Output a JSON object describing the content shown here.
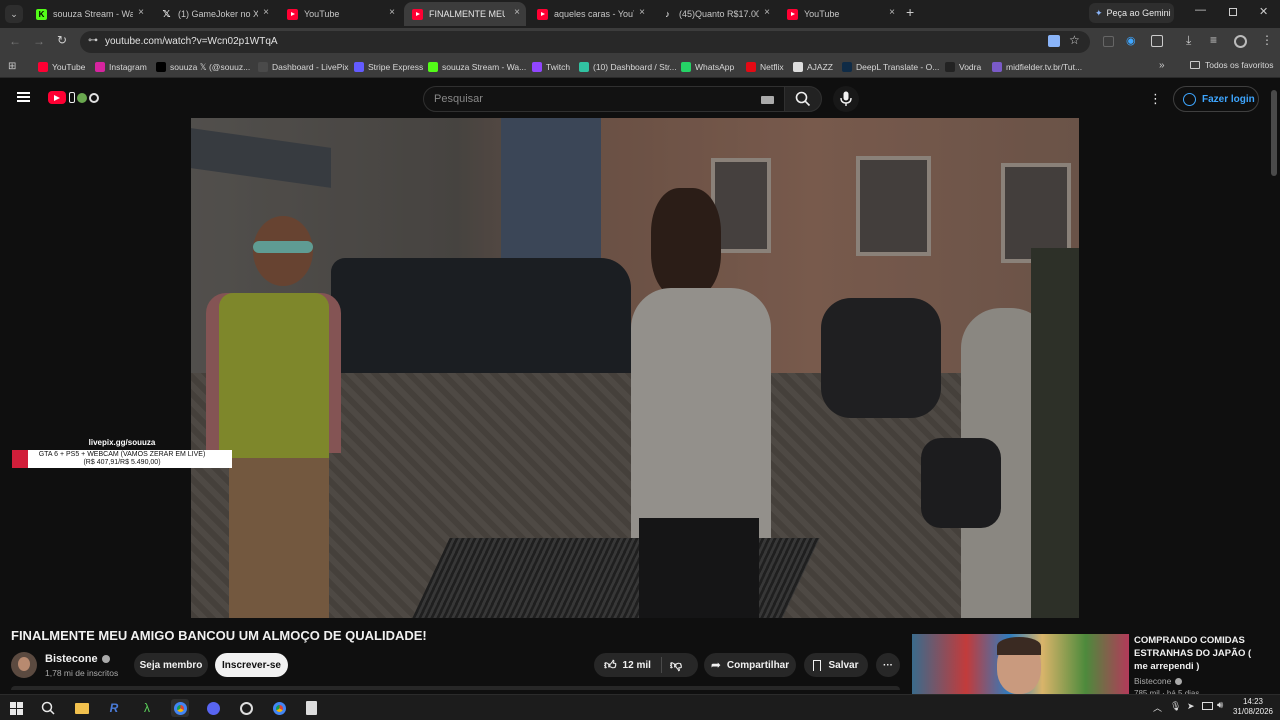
{
  "browser": {
    "tabs": [
      {
        "title": "souuza Stream - Wat",
        "icon": "kick-icon",
        "close": "×"
      },
      {
        "title": "(1) GameJoker no X: \"",
        "icon": "x-icon",
        "close": "×"
      },
      {
        "title": "YouTube",
        "icon": "youtube-icon",
        "close": "×"
      },
      {
        "title": "FINALMENTE MEU",
        "icon": "youtube-icon",
        "close": "×"
      },
      {
        "title": "aqueles caras - YouTu",
        "icon": "youtube-icon",
        "close": "×"
      },
      {
        "title": "(45)Quanto R$17.000",
        "icon": "tiktok-icon",
        "close": "×"
      },
      {
        "title": "YouTube",
        "icon": "youtube-icon",
        "close": "×"
      }
    ],
    "new_tab": "+",
    "gemini_label": "Peça ao Gemini",
    "url": "youtube.com/watch?v=Wcn02p1WTqA",
    "bookmarks": [
      {
        "label": "YouTube",
        "icon": "youtube-icon",
        "color": "#ff0033"
      },
      {
        "label": "Instagram",
        "icon": "instagram-icon",
        "color": "#d6249f"
      },
      {
        "label": "souuza 𝕏 (@souuz...",
        "icon": "x-icon",
        "color": "#000000"
      },
      {
        "label": "Dashboard - LivePix",
        "icon": "livepix-icon",
        "color": "#4a4a4a"
      },
      {
        "label": "Stripe Express",
        "icon": "stripe-icon",
        "color": "#635bff"
      },
      {
        "label": "souuza Stream - Wa...",
        "icon": "kick-icon",
        "color": "#53fc18"
      },
      {
        "label": "Twitch",
        "icon": "twitch-icon",
        "color": "#9146ff"
      },
      {
        "label": "(10) Dashboard / Str...",
        "icon": "streamlabs-icon",
        "color": "#31c3a2"
      },
      {
        "label": "WhatsApp",
        "icon": "whatsapp-icon",
        "color": "#25d366"
      },
      {
        "label": "Netflix",
        "icon": "netflix-icon",
        "color": "#e50914"
      },
      {
        "label": "AJAZZ",
        "icon": "ajazz-icon",
        "color": "#dddddd"
      },
      {
        "label": "DeepL Translate - O...",
        "icon": "deepl-icon",
        "color": "#0f2b46"
      },
      {
        "label": "Vodra",
        "icon": "vodra-icon",
        "color": "#222222"
      },
      {
        "label": "midfielder.tv.br/Tut...",
        "icon": "midfielder-icon",
        "color": "#7a5ac8"
      }
    ],
    "all_bookmarks": "Todos os favoritos",
    "more_bookmarks": "»"
  },
  "youtube": {
    "search_placeholder": "Pesquisar",
    "login_label": "Fazer login",
    "overlay_site": "livepix.gg/souuza",
    "overlay_goal": "GTA 6 + PS5 + WEBCAM (VAMOS ZERAR EM LIVE)",
    "overlay_amount": "(R$ 407,91/R$ 5.490,00)",
    "overlay_progress": 0.074,
    "video_title": "FINALMENTE MEU AMIGO BANCOU UM ALMOÇO DE QUALIDADE!",
    "channel_name": "Bistecone",
    "subscribers": "1,78 mi de inscritos",
    "join_label": "Seja membro",
    "subscribe_label": "Inscrever-se",
    "likes": "12 mil",
    "share_label": "Compartilhar",
    "save_label": "Salvar",
    "more_label": "···",
    "recommended": {
      "title": "COMPRANDO COMIDAS ESTRANHAS DO JAPÃO ( me arrependi )",
      "channel": "Bistecone",
      "meta": "785 mil · há 5 dias"
    }
  },
  "taskbar": {
    "time": "14:23",
    "date": "31/08/2026"
  },
  "colors": {
    "accent_blue": "#3ea6ff",
    "youtube_red": "#ff0033",
    "overlay_bar": "#d11e3a"
  }
}
